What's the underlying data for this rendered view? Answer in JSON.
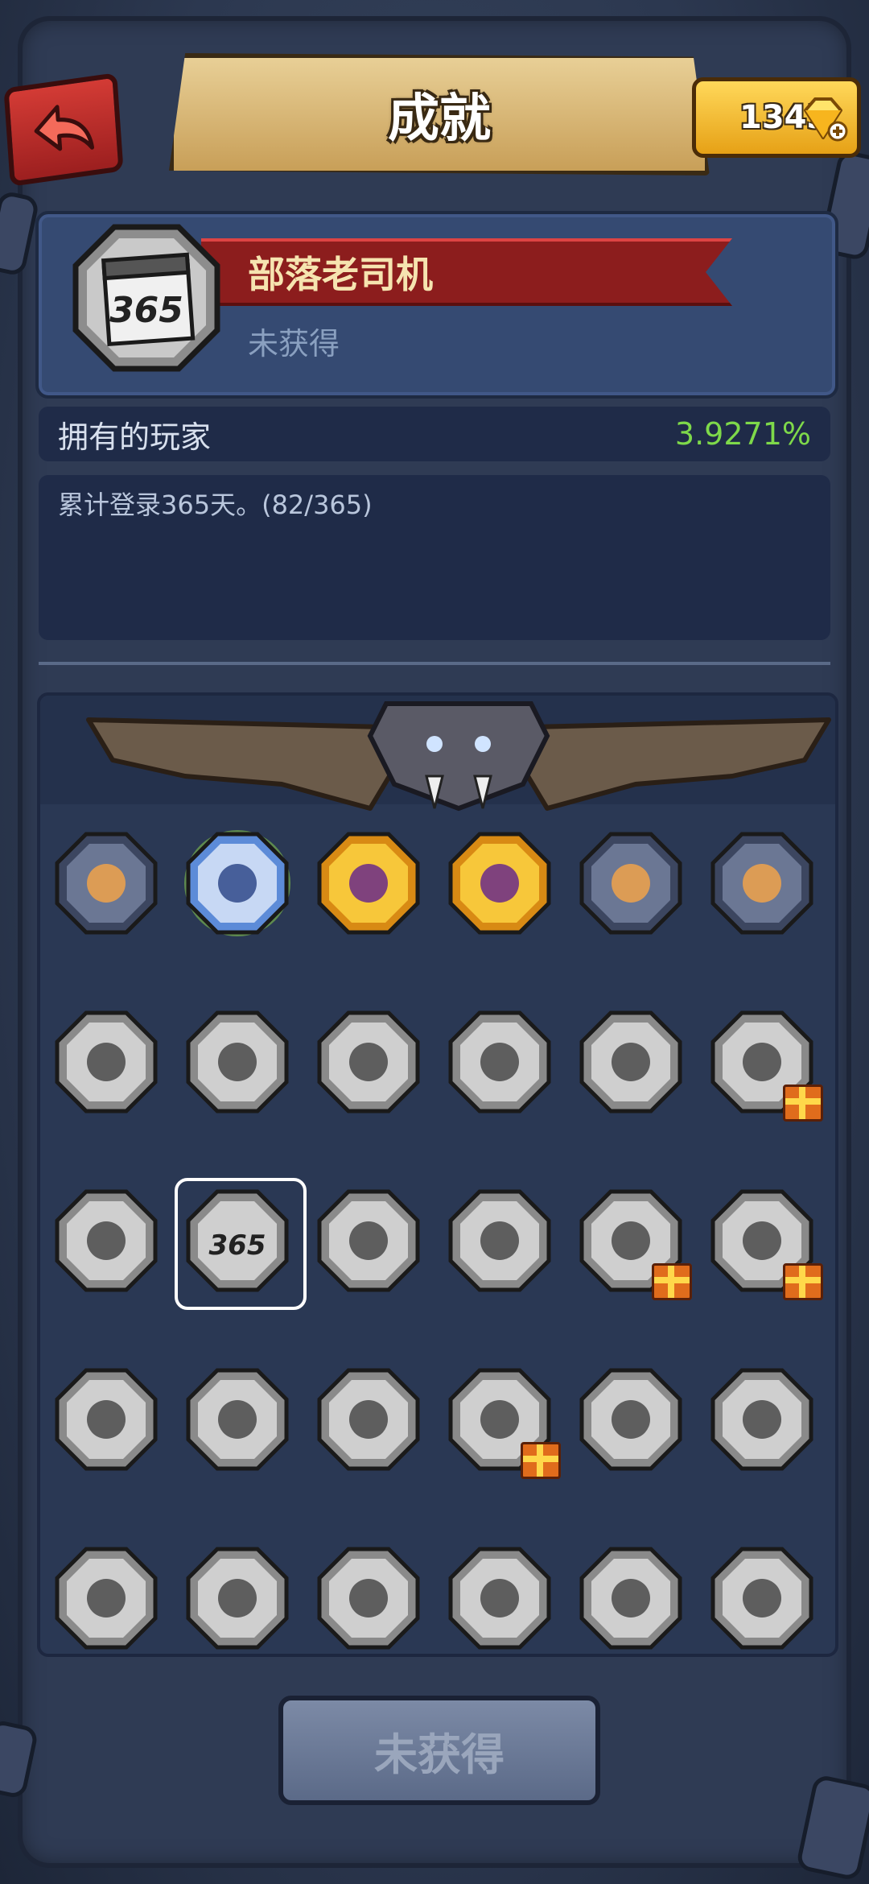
{
  "header": {
    "title": "成就",
    "back_icon": "back-arrow-icon",
    "currency": {
      "value": "1343",
      "icon": "gem-icon",
      "plus_icon": "plus-icon"
    }
  },
  "selected_achievement": {
    "icon_text": "365",
    "name": "部落老司机",
    "status": "未获得",
    "owners_label": "拥有的玩家",
    "owners_percent": "3.9271%",
    "description": "累计登录365天。(82/365)"
  },
  "grid": {
    "rows": [
      [
        {
          "id": "thumbs-up",
          "icon": "thumbs-up-icon",
          "state": "unlocked"
        },
        {
          "id": "skull-medal",
          "icon": "skull-icon",
          "state": "active"
        },
        {
          "id": "purple-warrior",
          "icon": "warrior-icon",
          "state": "gold"
        },
        {
          "id": "ice-beast",
          "icon": "ice-beast-icon",
          "state": "gold"
        },
        {
          "id": "yak-rider",
          "icon": "yak-icon",
          "state": "unlocked"
        },
        {
          "id": "tired-chief",
          "icon": "chief-icon",
          "state": "unlocked"
        }
      ],
      [
        {
          "id": "dragon-3",
          "icon": "dragon-icon",
          "state": "locked"
        },
        {
          "id": "dragon-stars-1",
          "icon": "dragon-icon",
          "state": "locked"
        },
        {
          "id": "dragon-stars-2",
          "icon": "dragon-icon",
          "state": "locked"
        },
        {
          "id": "stone-heads",
          "icon": "stone-icon",
          "state": "locked"
        },
        {
          "id": "mirror",
          "icon": "mirror-icon",
          "state": "locked"
        },
        {
          "id": "sign-2",
          "icon": "sign-icon",
          "state": "locked",
          "gift": true
        }
      ],
      [
        {
          "id": "paper",
          "icon": "paper-icon",
          "state": "locked"
        },
        {
          "id": "calendar-365",
          "icon": "calendar-icon",
          "state": "locked",
          "label": "365",
          "selected": true
        },
        {
          "id": "whale",
          "icon": "whale-icon",
          "state": "locked"
        },
        {
          "id": "trophy",
          "icon": "trophy-icon",
          "state": "locked"
        },
        {
          "id": "gorilla",
          "icon": "gorilla-icon",
          "state": "locked",
          "gift": true
        },
        {
          "id": "monster",
          "icon": "monster-icon",
          "state": "locked",
          "gift": true
        }
      ],
      [
        {
          "id": "bear-stars",
          "icon": "bear-icon",
          "state": "locked"
        },
        {
          "id": "axe-rock",
          "icon": "axe-icon",
          "state": "locked"
        },
        {
          "id": "egg",
          "icon": "egg-icon",
          "state": "locked"
        },
        {
          "id": "feather-chief",
          "icon": "feather-icon",
          "state": "locked",
          "gift": true
        },
        {
          "id": "sun",
          "icon": "sun-icon",
          "state": "locked"
        },
        {
          "id": "bag-up",
          "icon": "bag-icon",
          "state": "locked"
        }
      ],
      [
        {
          "id": "caveman",
          "icon": "caveman-icon",
          "state": "locked"
        },
        {
          "id": "wings-1",
          "icon": "wings-icon",
          "state": "locked"
        },
        {
          "id": "wings-2",
          "icon": "wings-icon",
          "state": "locked"
        },
        {
          "id": "wings-3",
          "icon": "wings-icon",
          "state": "locked"
        },
        {
          "id": "caveman-2",
          "icon": "caveman-icon",
          "state": "locked"
        },
        {
          "id": "rock-pile",
          "icon": "rock-icon",
          "state": "locked"
        }
      ]
    ]
  },
  "bottom_button": {
    "label": "未获得"
  },
  "colors": {
    "accent_gold": "#f2c23a",
    "ribbon_red": "#8c1d1d",
    "percent_green": "#7ed94a"
  }
}
